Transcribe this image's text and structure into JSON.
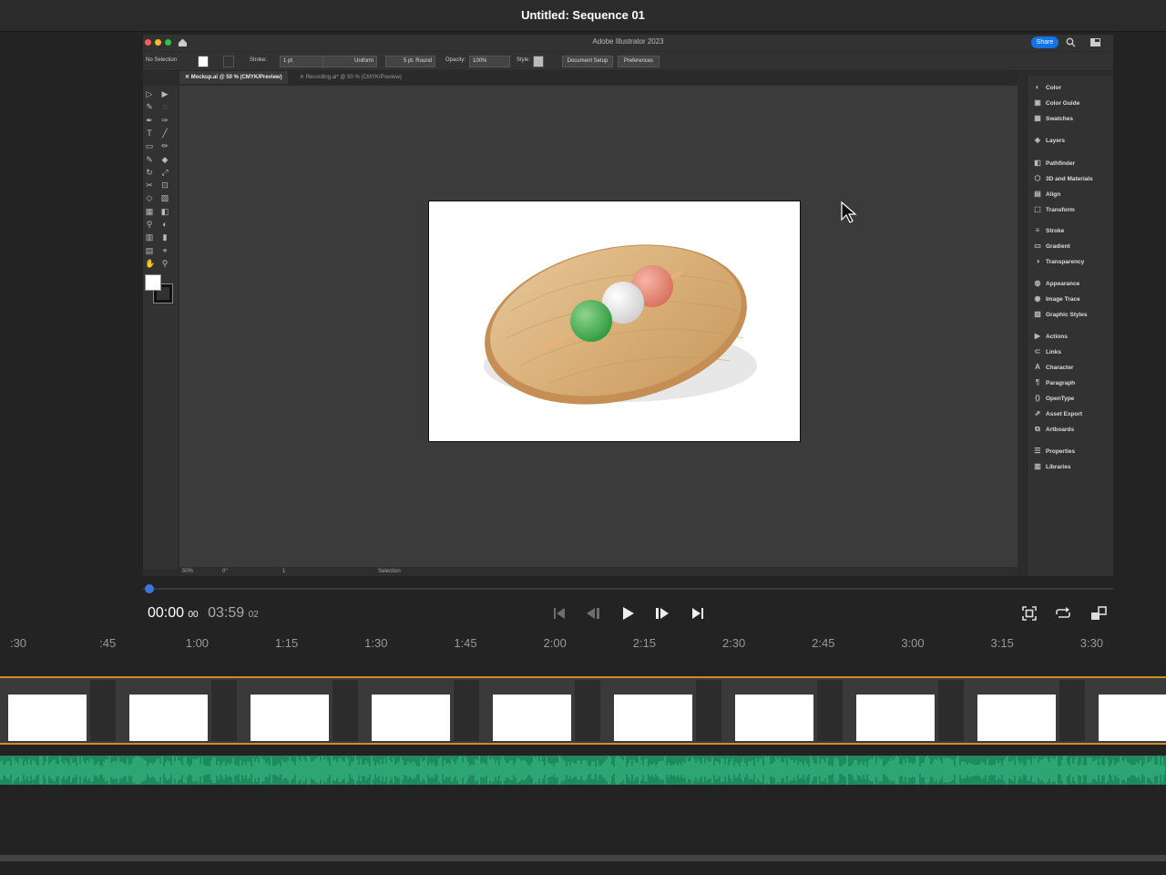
{
  "window": {
    "title": "Untitled: Sequence 01"
  },
  "illustrator": {
    "app_title": "Adobe Illustrator 2023",
    "share_label": "Share",
    "control_bar": {
      "selection": "No Selection",
      "stroke_label": "Stroke:",
      "stroke_value": "1 pt",
      "profile": "Uniform",
      "brush": "5 pt. Round",
      "opacity_label": "Opacity:",
      "opacity_value": "100%",
      "style_label": "Style:",
      "document_setup": "Document Setup",
      "preferences": "Preferences"
    },
    "tabs": [
      {
        "label": "Mockup.ai @ 50 % (CMYK/Preview)",
        "active": true
      },
      {
        "label": "Recording.ai* @ 50 % (CMYK/Preview)",
        "active": false
      }
    ],
    "status": {
      "zoom": "50%",
      "rotate": "0°",
      "artboard": "1",
      "tool": "Selection"
    },
    "panels": [
      {
        "label": "Color",
        "icon": "color-icon"
      },
      {
        "label": "Color Guide",
        "icon": "color-guide-icon"
      },
      {
        "label": "Swatches",
        "icon": "swatches-icon"
      },
      {
        "label": "Layers",
        "icon": "layers-icon"
      },
      {
        "label": "Pathfinder",
        "icon": "pathfinder-icon"
      },
      {
        "label": "3D and Materials",
        "icon": "3d-icon"
      },
      {
        "label": "Align",
        "icon": "align-icon"
      },
      {
        "label": "Transform",
        "icon": "transform-icon"
      },
      {
        "label": "Stroke",
        "icon": "stroke-icon"
      },
      {
        "label": "Gradient",
        "icon": "gradient-icon"
      },
      {
        "label": "Transparency",
        "icon": "transparency-icon"
      },
      {
        "label": "Appearance",
        "icon": "appearance-icon"
      },
      {
        "label": "Image Trace",
        "icon": "image-trace-icon"
      },
      {
        "label": "Graphic Styles",
        "icon": "graphic-styles-icon"
      },
      {
        "label": "Actions",
        "icon": "actions-icon"
      },
      {
        "label": "Links",
        "icon": "links-icon"
      },
      {
        "label": "Character",
        "icon": "character-icon"
      },
      {
        "label": "Paragraph",
        "icon": "paragraph-icon"
      },
      {
        "label": "OpenType",
        "icon": "opentype-icon"
      },
      {
        "label": "Asset Export",
        "icon": "asset-export-icon"
      },
      {
        "label": "Artboards",
        "icon": "artboards-icon"
      },
      {
        "label": "Properties",
        "icon": "properties-icon"
      },
      {
        "label": "Libraries",
        "icon": "libraries-icon"
      }
    ]
  },
  "player": {
    "current_time": "00:00",
    "current_frames": "00",
    "duration": "03:59",
    "duration_frames": "02",
    "playhead_fraction": 0
  },
  "timeline": {
    "ruler": [
      ":30",
      ":45",
      "1:00",
      "1:15",
      "1:30",
      "1:45",
      "2:00",
      "2:15",
      "2:30",
      "2:45",
      "3:00",
      "3:15",
      "3:30"
    ]
  },
  "colors": {
    "accent": "#3c78d8",
    "clip_border": "#d38a25",
    "audio": "#1e8a5e"
  }
}
